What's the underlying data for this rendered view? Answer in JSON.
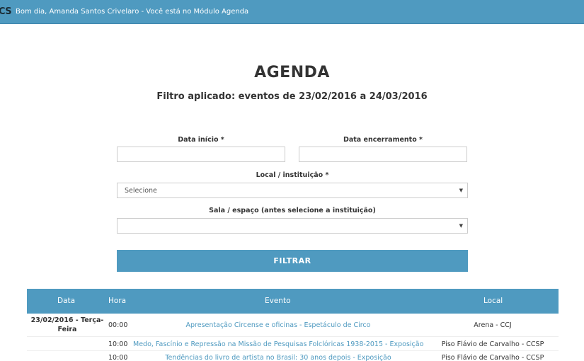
{
  "header": {
    "logo": "CS",
    "greeting": "Bom dia, Amanda Santos Crivelaro - Você está no Módulo Agenda"
  },
  "page": {
    "title": "AGENDA",
    "filter_summary": "Filtro aplicado: eventos de 23/02/2016 a 24/03/2016"
  },
  "form": {
    "start_date_label": "Data início *",
    "start_date_value": "",
    "end_date_label": "Data encerramento *",
    "end_date_value": "",
    "local_label": "Local / instituição *",
    "local_selected": "Selecione",
    "room_label": "Sala / espaço (antes selecione a instituição)",
    "room_selected": "",
    "filter_button": "FILTRAR"
  },
  "table": {
    "columns": [
      "Data",
      "Hora",
      "Evento",
      "Local"
    ],
    "rows": [
      {
        "date": "23/02/2016 - Terça-Feira",
        "time": "00:00",
        "event": "Apresentação Circense e oficinas - Espetáculo de Circo",
        "local": "Arena - CCJ"
      },
      {
        "date": "",
        "time": "10:00",
        "event": "Medo, Fascínio e Repressão na Missão de Pesquisas Folclóricas 1938-2015 - Exposição",
        "local": "Piso Flávio de Carvalho - CCSP"
      },
      {
        "date": "",
        "time": "10:00",
        "event": "Tendências do livro de artista no Brasil: 30 anos depois - Exposição",
        "local": "Piso Flávio de Carvalho - CCSP"
      }
    ]
  },
  "colors": {
    "accent": "#4f9ac0",
    "link": "#4f9ac0"
  }
}
